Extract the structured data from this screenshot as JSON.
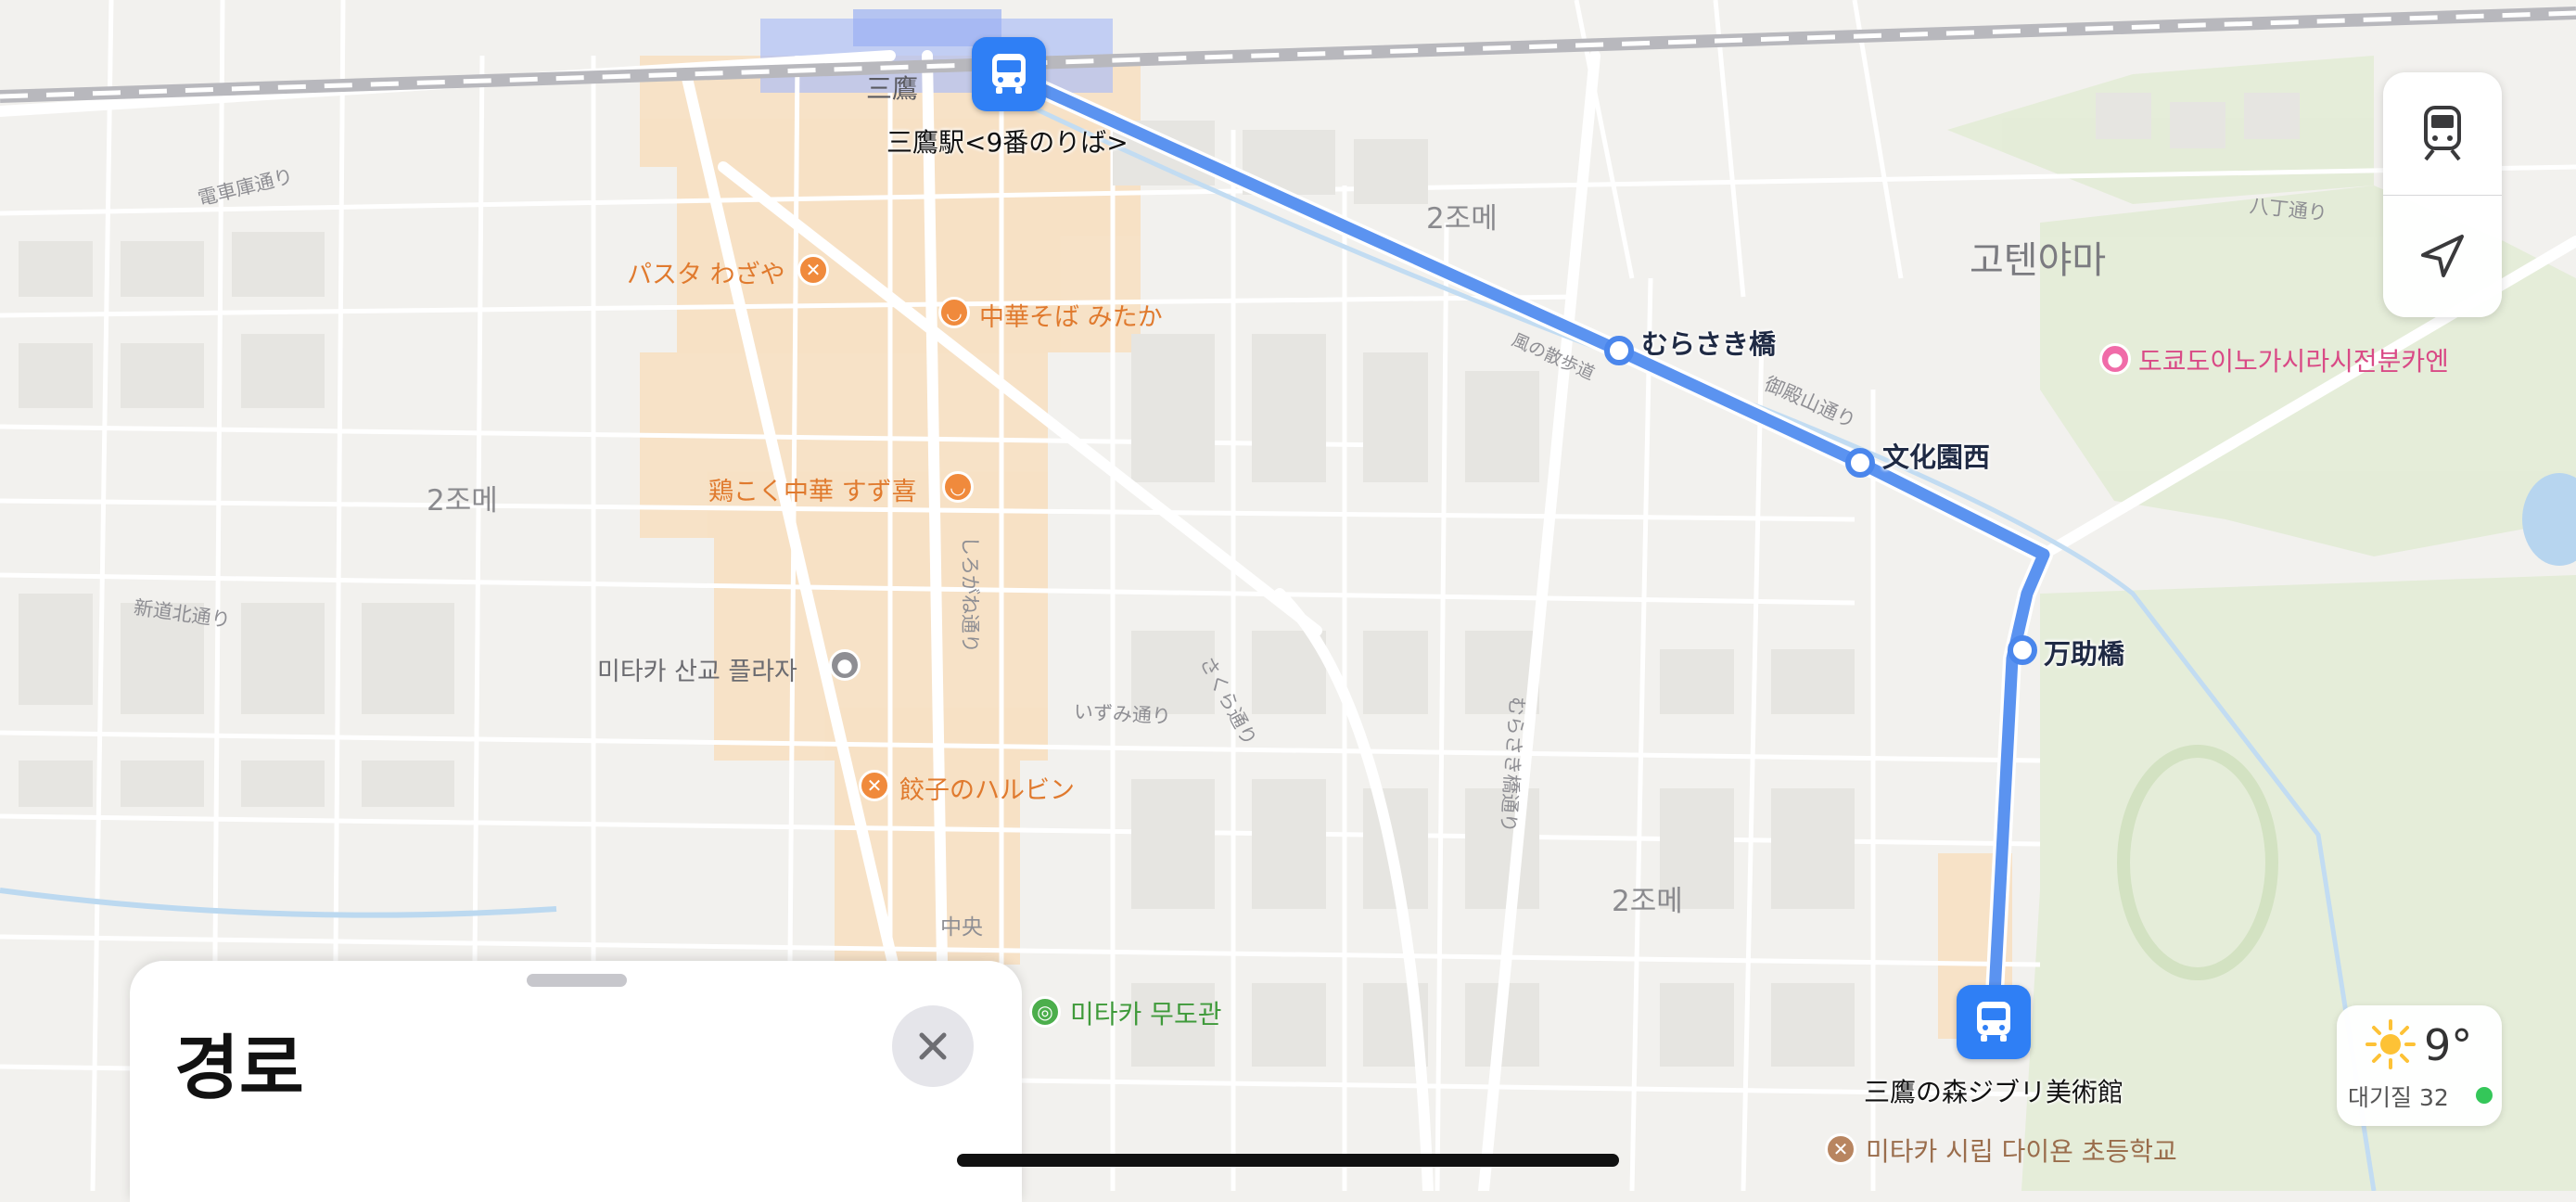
{
  "map": {
    "district_labels": [
      "2조메",
      "2조메",
      "2조메",
      "三鷹"
    ],
    "area_label": "고텐야마",
    "street_labels": [
      "電車庫通り",
      "新道北通り",
      "風の散歩道",
      "御殿山通り",
      "しろがね通り",
      "さくら通り",
      "むらさき橋通り",
      "いずみ通り",
      "八丁通り",
      "中央"
    ],
    "pois": [
      {
        "name": "パスタ わざや",
        "icon": "fork-knife-icon",
        "color": "#f08a3c"
      },
      {
        "name": "中華そば みたか",
        "icon": "noodle-bowl-icon",
        "color": "#f08a3c"
      },
      {
        "name": "鶏こく中華 すず喜",
        "icon": "noodle-bowl-icon",
        "color": "#f08a3c"
      },
      {
        "name": "미타카 산교 플라자",
        "icon": "dot-icon",
        "color": "#8e8e93"
      },
      {
        "name": "餃子のハルビン",
        "icon": "fork-knife-icon",
        "color": "#f08a3c"
      },
      {
        "name": "미타카 무도관",
        "icon": "sports-icon",
        "color": "#4cae4c"
      },
      {
        "name": "도쿄도이노가시라시전분카엔",
        "icon": "elephant-icon",
        "color": "#f06ba8"
      },
      {
        "name": "미타카 시립 다이욘 초등학교",
        "icon": "school-icon",
        "color": "#b88560"
      }
    ],
    "route": {
      "color": "#5b93f0",
      "start": {
        "label": "三鷹駅<9番のりば>",
        "icon": "bus-icon"
      },
      "end": {
        "label": "三鷹の森ジブリ美術館",
        "icon": "bus-icon"
      },
      "stops": [
        "むらさき橋",
        "文化園西",
        "万助橋"
      ]
    }
  },
  "controls": {
    "transit_icon": "train-icon",
    "location_icon": "location-arrow-icon"
  },
  "weather": {
    "icon": "sun-icon",
    "temperature": "9°",
    "air_quality_label": "대기질 32",
    "aqi_color": "#34c759"
  },
  "sheet": {
    "title": "경로",
    "close_icon": "close-icon"
  }
}
